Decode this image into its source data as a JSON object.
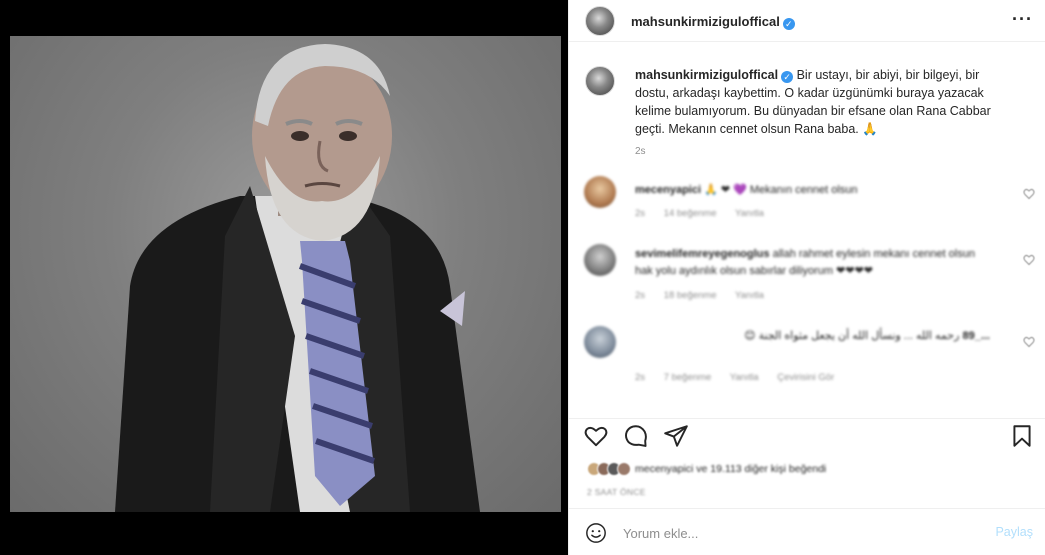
{
  "post": {
    "username": "mahsunkirmiziguloffical",
    "header_username": "mahsunkirmiziguloffical",
    "verified": true,
    "caption": "Bir ustayı, bir abiyi, bir bilgeyi, bir dostu, arkadaşı kaybettim. O kadar üzgünümki buraya yazacak kelime bulamıyorum. Bu dünyadan bir efsane olan Rana Cabbar geçti. Mekanın cennet olsun Rana baba. 🙏",
    "caption_time": "2s",
    "more_icon": "more-horizontal-icon",
    "verified_icon": "verified-badge-icon"
  },
  "comments": [
    {
      "username": "mecenyapici",
      "text": "🙏 ❤ 💜 Mekanın cennet olsun",
      "time": "2s",
      "likes": "14 beğenme",
      "reply": "Yanıtla",
      "avatar_color": "#c9a77a"
    },
    {
      "username": "sevimelifemreyegenoglus",
      "text": "allah rahmet eylesin mekanı cennet olsun hak yolu aydınlık olsun sabırlar diliyorum ❤❤❤❤",
      "time": "2s",
      "likes": "18 beğenme",
      "reply": "Yanıtla",
      "avatar_color": "#8a8a8a"
    },
    {
      "username": "..._89",
      "text": "رحمه الله ... ونسأل الله أن يجعل مثواه الجنة 😊",
      "time": "2s",
      "likes": "7 beğenme",
      "reply": "Yanıtla",
      "replies": "Çevirisini Gör",
      "avatar_color": "#7d8a9a"
    }
  ],
  "actions": {
    "like_icon": "heart-icon",
    "comment_icon": "comment-icon",
    "share_icon": "send-icon",
    "save_icon": "bookmark-icon"
  },
  "likes": {
    "text": "mecenyapici ve 19.113 diğer kişi beğendi"
  },
  "date": "2 SAAT ÖNCE",
  "add_comment": {
    "placeholder": "Yorum ekle...",
    "share_label": "Paylaş",
    "emoji_icon": "emoji-smile-icon"
  },
  "colors": {
    "accent": "#3897f0",
    "share_disabled": "#b2dffc",
    "muted": "#8e8e8e",
    "border": "#efefef"
  }
}
